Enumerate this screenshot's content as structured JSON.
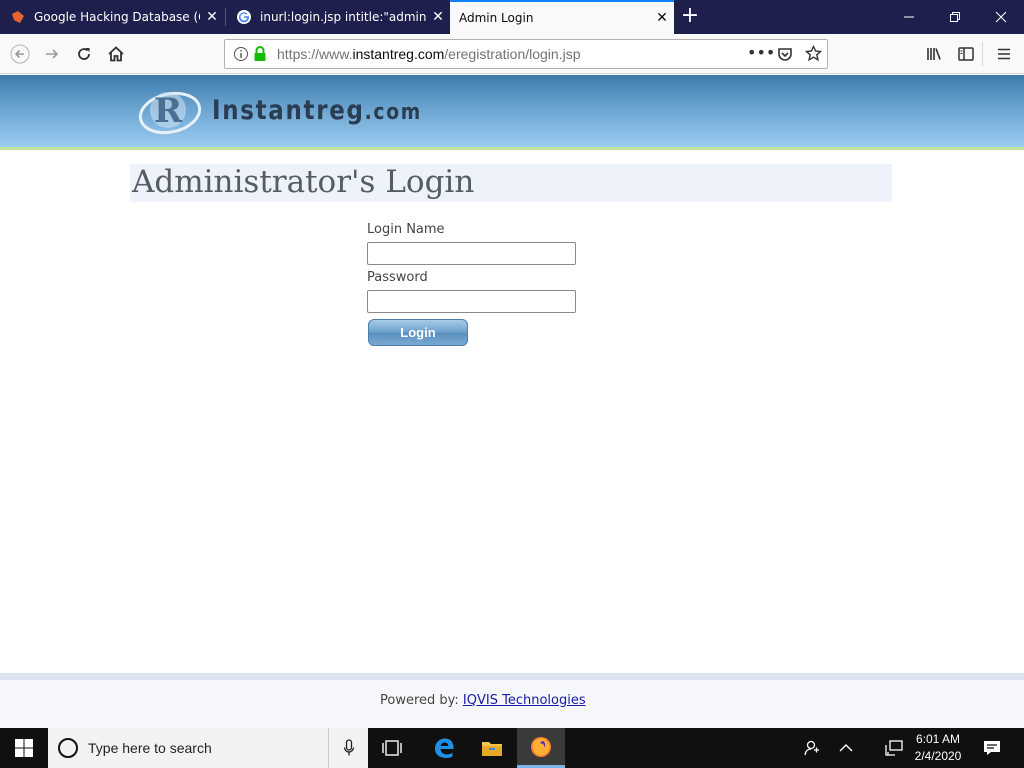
{
  "browser": {
    "tabs": [
      {
        "title": "Google Hacking Database (GHDB)",
        "favicon": "exploit-db-icon"
      },
      {
        "title": "inurl:login.jsp intitle:\"admin\" - Google Search",
        "favicon": "google-icon"
      },
      {
        "title": "Admin Login",
        "favicon": "",
        "active": true
      }
    ],
    "url_prefix": "https://www.",
    "url_domain": "instantreg.com",
    "url_path": "/eregistration/login.jsp"
  },
  "page": {
    "logo_text": "Instantreg",
    "logo_suffix": ".com",
    "logo_mark_letter": "R",
    "heading": "Administrator's Login",
    "login_name_label": "Login Name",
    "login_name_value": "",
    "password_label": "Password",
    "password_value": "",
    "login_button": "Login",
    "footer_prefix": "Powered by:",
    "footer_link": "IQVIS Technologies"
  },
  "taskbar": {
    "search_placeholder": "Type here to search",
    "time": "6:01 AM",
    "date": "2/4/2020"
  },
  "colors": {
    "tabbar": "#1f1f4d",
    "accent": "#0a84ff",
    "banner_top": "#3d7bad",
    "banner_bottom": "#9cccf1",
    "banner_line": "#c3e49c"
  }
}
